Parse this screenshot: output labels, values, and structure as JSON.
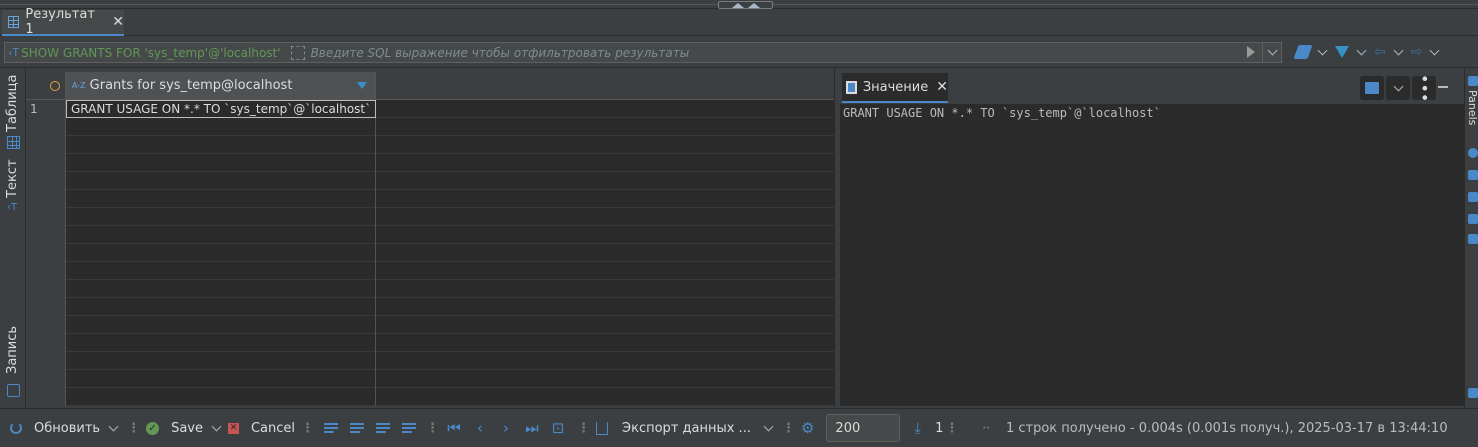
{
  "tab": {
    "label": "Результат 1",
    "close": "✕"
  },
  "filter": {
    "query": "SHOW GRANTS FOR 'sys_temp'@'localhost'",
    "placeholder": "Введите SQL выражение чтобы отфильтровать результаты"
  },
  "side_tabs": {
    "table": "Таблица",
    "text": "Текст",
    "record": "Запись"
  },
  "grid": {
    "column_header": "Grants for sys_temp@localhost",
    "rows": [
      {
        "num": "1",
        "value": "GRANT USAGE ON *.* TO `sys_temp`@`localhost`"
      }
    ]
  },
  "value_panel": {
    "tab_label": "Значение",
    "close": "✕",
    "content": "GRANT USAGE ON *.* TO `sys_temp`@`localhost`"
  },
  "right_panel": {
    "label": "Panels"
  },
  "bottom": {
    "refresh": "Обновить",
    "save": "Save",
    "cancel": "Cancel",
    "export": "Экспорт данных ...",
    "fetch_size": "200",
    "fetch_count": "1",
    "status": "1 строк получено - 0.004s (0.001s получ.), 2025-03-17 в 13:44:10"
  }
}
